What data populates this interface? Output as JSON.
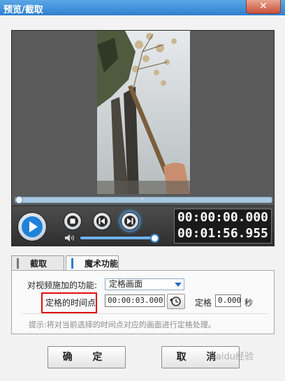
{
  "window": {
    "title": "预览/截取",
    "close_glyph": "✕"
  },
  "player": {
    "time_current": "00:00:00.000",
    "time_total": "00:01:56.955",
    "seek_position": 0.0,
    "volume_level": 0.95,
    "collapse_glyph": "⌄"
  },
  "tabs": [
    {
      "label": "截取",
      "active": false
    },
    {
      "label": "魔术功能",
      "active": true
    }
  ],
  "magic": {
    "function_label": "对视频施加的功能:",
    "function_value": "定格画面",
    "time_label": "定格的时间点",
    "time_value": "00:00:03.000",
    "freeze_label": "定格",
    "freeze_value": "0.000",
    "unit": "秒",
    "hint": "提示:将对当前选择的时间点对应的画面进行定格处理。"
  },
  "buttons": {
    "ok": "确 定",
    "cancel": "取 消"
  },
  "watermark": "Baidu经验",
  "colors": {
    "accent": "#2f7fcf",
    "highlight": "#e01010"
  }
}
